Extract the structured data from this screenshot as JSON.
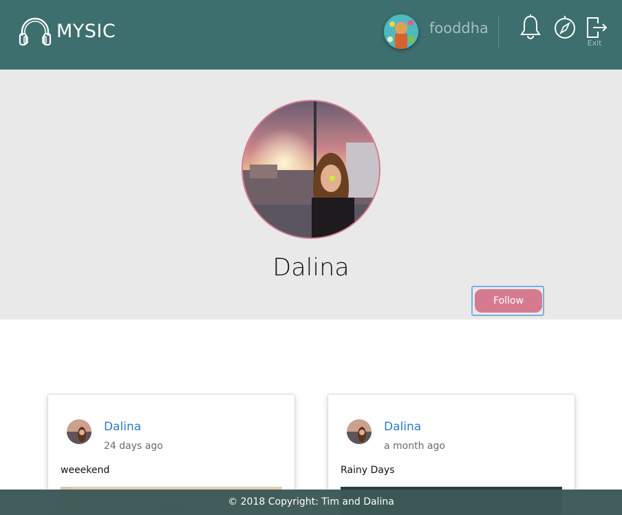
{
  "header": {
    "logo_text": "MYSIC",
    "username": "fooddha",
    "exit_label": "Exit",
    "bg_color": "#3c6f6e"
  },
  "profile": {
    "name": "Dalina",
    "follow_label": "Follow",
    "accent_color": "#d67b8f"
  },
  "posts": [
    {
      "author": "Dalina",
      "time": "24 days ago",
      "text": "weeekend"
    },
    {
      "author": "Dalina",
      "time": "a month ago",
      "text": "Rainy Days"
    }
  ],
  "footer": {
    "text": "© 2018 Copyright: Tim and Dalina"
  }
}
